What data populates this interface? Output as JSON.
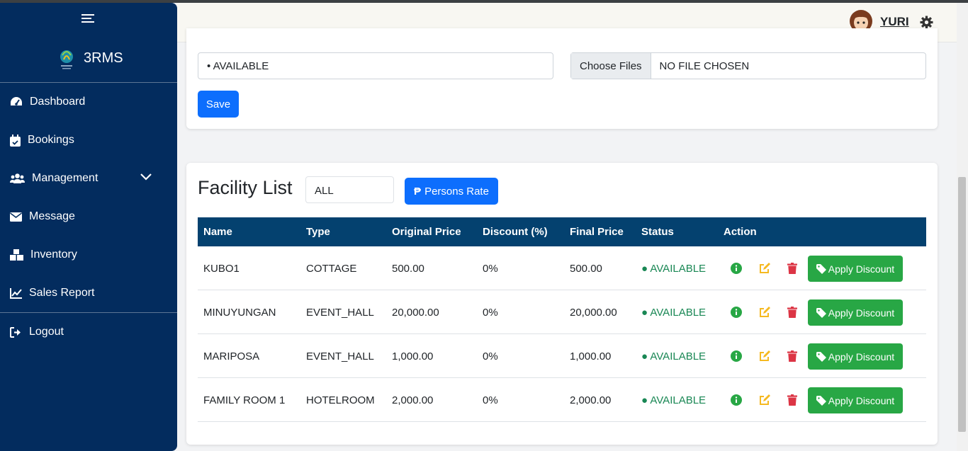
{
  "sidebar": {
    "brand": "3RMS",
    "items": [
      {
        "label": "Dashboard",
        "icon": "dashboard-icon"
      },
      {
        "label": "Bookings",
        "icon": "calendar-check-icon"
      },
      {
        "label": "Management",
        "icon": "users-icon"
      },
      {
        "label": "Message",
        "icon": "envelope-icon"
      },
      {
        "label": "Inventory",
        "icon": "boxes-icon"
      },
      {
        "label": "Sales Report",
        "icon": "chart-line-icon"
      }
    ],
    "logout": "Logout"
  },
  "header": {
    "username": "YURI"
  },
  "form": {
    "status_value": "• AVAILABLE",
    "file_button": "Choose Files",
    "file_name": "NO FILE CHOSEN",
    "save_label": "Save"
  },
  "facility": {
    "title": "Facility List",
    "filter_value": "ALL",
    "persons_rate_label": "Persons Rate",
    "columns": [
      "Name",
      "Type",
      "Original Price",
      "Discount (%)",
      "Final Price",
      "Status",
      "Action"
    ],
    "rows": [
      {
        "name": "KUBO1",
        "type": "COTTAGE",
        "original_price": "500.00",
        "discount": "0%",
        "final_price": "500.00",
        "status": "● AVAILABLE",
        "apply_label": "Apply Discount"
      },
      {
        "name": "MINUYUNGAN",
        "type": "EVENT_HALL",
        "original_price": "20,000.00",
        "discount": "0%",
        "final_price": "20,000.00",
        "status": "● AVAILABLE",
        "apply_label": "Apply Discount"
      },
      {
        "name": "MARIPOSA",
        "type": "EVENT_HALL",
        "original_price": "1,000.00",
        "discount": "0%",
        "final_price": "1,000.00",
        "status": "● AVAILABLE",
        "apply_label": "Apply Discount"
      },
      {
        "name": "FAMILY ROOM 1",
        "type": "HOTELROOM",
        "original_price": "2,000.00",
        "discount": "0%",
        "final_price": "2,000.00",
        "status": "● AVAILABLE",
        "apply_label": "Apply Discount"
      }
    ]
  },
  "colors": {
    "sidebar_bg": "#032c5e",
    "table_header_bg": "#04416f",
    "primary": "#0d6efd",
    "success": "#28a745",
    "info": "#28a745",
    "edit": "#f5b921",
    "delete": "#dc3545"
  }
}
